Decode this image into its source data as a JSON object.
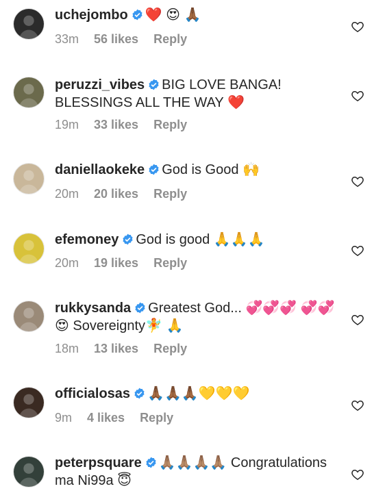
{
  "comments": [
    {
      "username": "uchejombo",
      "text": "❤️ 😍 🙏🏾",
      "time": "33m",
      "likes": "56 likes",
      "reply": "Reply",
      "avatar_color": "#2b2b2b"
    },
    {
      "username": "peruzzi_vibes",
      "text": "BIG LOVE BANGA! BLESSINGS ALL THE WAY ❤️",
      "time": "19m",
      "likes": "33 likes",
      "reply": "Reply",
      "avatar_color": "#6b6a4c"
    },
    {
      "username": "daniellaokeke",
      "text": "God is Good 🙌",
      "time": "20m",
      "likes": "20 likes",
      "reply": "Reply",
      "avatar_color": "#c9b79a"
    },
    {
      "username": "efemoney",
      "text": "God is good 🙏🙏🙏",
      "time": "20m",
      "likes": "19 likes",
      "reply": "Reply",
      "avatar_color": "#d8c23a"
    },
    {
      "username": "rukkysanda",
      "text": "Greatest God... 💞💞💞 💞💞😍 Sovereignty🧚 🙏",
      "time": "18m",
      "likes": "13 likes",
      "reply": "Reply",
      "avatar_color": "#9a8a78"
    },
    {
      "username": "officialosas",
      "text": "🙏🏾🙏🏾🙏🏾💛💛💛",
      "time": "9m",
      "likes": "4 likes",
      "reply": "Reply",
      "avatar_color": "#3a2a22"
    },
    {
      "username": "peterpsquare",
      "text": "🙏🏽🙏🏽🙏🏽🙏🏽 Congratulations ma Ni99a 😇",
      "time": "",
      "likes": "",
      "reply": "",
      "avatar_color": "#33403a"
    }
  ],
  "colors": {
    "verified": "#3897f0",
    "meta": "#8e8e8e",
    "text": "#262626"
  },
  "icons": {
    "verified": "verified-badge-icon",
    "like": "heart-outline-icon"
  }
}
